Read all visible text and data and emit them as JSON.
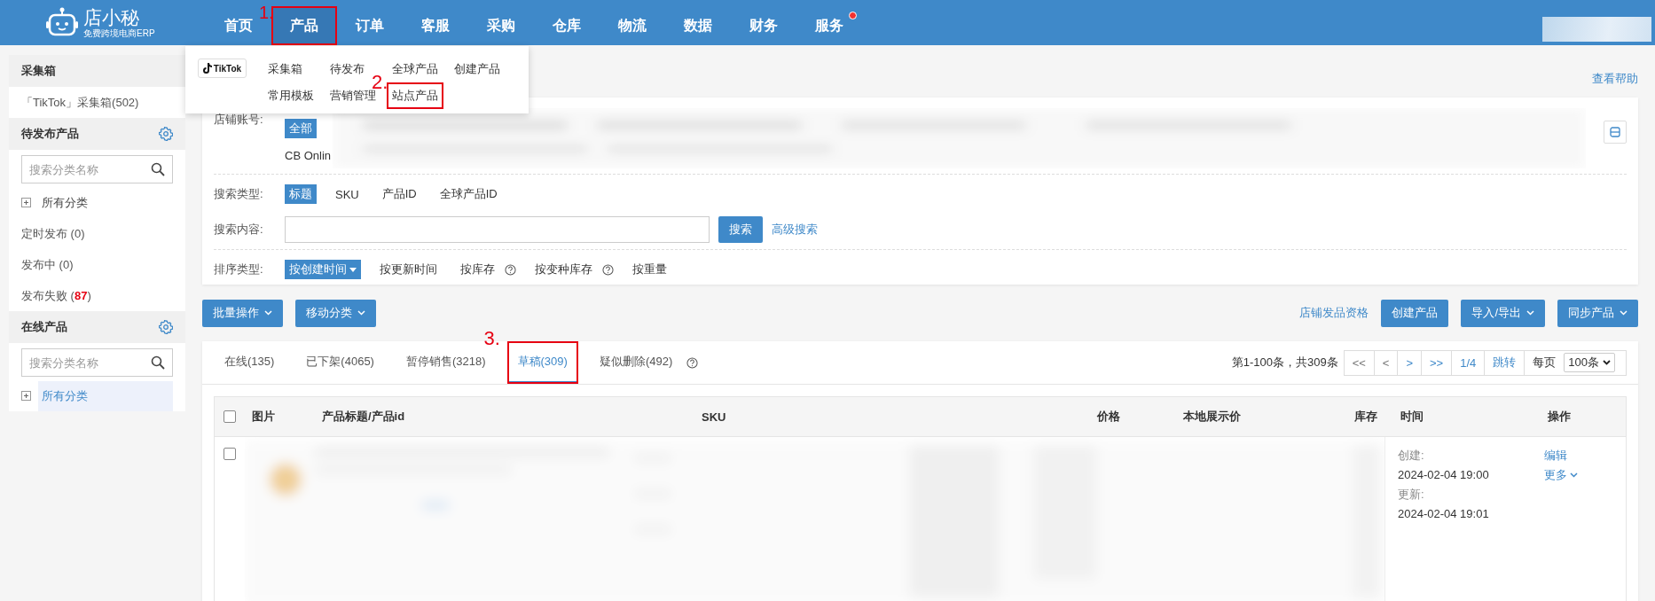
{
  "nav": {
    "logo": {
      "name": "店小秘",
      "tagline": "免费跨境电商ERP"
    },
    "items": [
      {
        "label": "首页",
        "selected": false,
        "dot": false
      },
      {
        "label": "产品",
        "selected": true,
        "dot": false,
        "annotation": "1."
      },
      {
        "label": "订单",
        "selected": false,
        "dot": false
      },
      {
        "label": "客服",
        "selected": false,
        "dot": false
      },
      {
        "label": "采购",
        "selected": false,
        "dot": false
      },
      {
        "label": "仓库",
        "selected": false,
        "dot": false
      },
      {
        "label": "物流",
        "selected": false,
        "dot": false
      },
      {
        "label": "数据",
        "selected": false,
        "dot": false
      },
      {
        "label": "财务",
        "selected": false,
        "dot": false
      },
      {
        "label": "服务",
        "selected": false,
        "dot": true
      }
    ]
  },
  "dropdown": {
    "brand": "TikTok",
    "rows": [
      [
        {
          "label": "采集箱"
        },
        {
          "label": "待发布"
        },
        {
          "label": "全球产品"
        },
        {
          "label": "创建产品"
        }
      ],
      [
        {
          "label": "常用模板"
        },
        {
          "label": "营销管理"
        },
        {
          "label": "站点产品",
          "annotation": "2."
        }
      ]
    ]
  },
  "help_link": "查看帮助",
  "sidebar": [
    {
      "title": "采集箱",
      "settings": false,
      "items": [
        {
          "kind": "link",
          "label": "「TikTok」采集箱(502)",
          "selected": false
        }
      ]
    },
    {
      "title": "待发布产品",
      "settings": true,
      "search_placeholder": "搜索分类名称",
      "items": [
        {
          "kind": "tree",
          "label": "所有分类",
          "selected": false
        },
        {
          "kind": "link",
          "label": "定时发布 (0)",
          "selected": false
        },
        {
          "kind": "link",
          "label": "发布中 (0)",
          "selected": false
        },
        {
          "kind": "link",
          "label": "发布失败 (**87**)",
          "selected": false
        }
      ]
    },
    {
      "title": "在线产品",
      "settings": true,
      "search_placeholder": "搜索分类名称",
      "items": [
        {
          "kind": "tree",
          "label": "所有分类",
          "selected": true
        }
      ]
    }
  ],
  "filters": {
    "store": {
      "label": "店铺账号:",
      "options": [
        {
          "label": "全部",
          "selected": true
        }
      ],
      "account": "CB Onlin"
    },
    "search_type": {
      "label": "搜索类型:",
      "options": [
        {
          "label": "标题",
          "selected": true
        },
        {
          "label": "SKU",
          "selected": false
        },
        {
          "label": "产品ID",
          "selected": false
        },
        {
          "label": "全球产品ID",
          "selected": false
        }
      ]
    },
    "search_content": {
      "label": "搜索内容:",
      "button": "搜索",
      "link": "高级搜索"
    },
    "sort": {
      "label": "排序类型:",
      "options": [
        {
          "label": "按创建时间",
          "selected": true,
          "dropdown": true,
          "help": false
        },
        {
          "label": "按更新时间",
          "selected": false,
          "dropdown": false,
          "help": false
        },
        {
          "label": "按库存",
          "selected": false,
          "dropdown": false,
          "help": true
        },
        {
          "label": "按变种库存",
          "selected": false,
          "dropdown": false,
          "help": true
        },
        {
          "label": "按重量",
          "selected": false,
          "dropdown": false,
          "help": false
        }
      ]
    }
  },
  "actions": {
    "left": [
      {
        "label": "批量操作",
        "caret": true
      },
      {
        "label": "移动分类",
        "caret": true
      }
    ],
    "link": "店铺发品资格",
    "right": [
      {
        "label": "创建产品",
        "caret": false
      },
      {
        "label": "导入/导出",
        "caret": true
      },
      {
        "label": "同步产品",
        "caret": true
      }
    ]
  },
  "tabs": [
    {
      "label": "在线(135)",
      "selected": false,
      "help": false
    },
    {
      "label": "已下架(4065)",
      "selected": false,
      "help": false
    },
    {
      "label": "暂停销售(3218)",
      "selected": false,
      "help": false
    },
    {
      "label": "草稿(309)",
      "selected": true,
      "help": false,
      "annotation": "3."
    },
    {
      "label": "疑似删除(492)",
      "selected": false,
      "help": true
    }
  ],
  "pagination": {
    "summary": "第1-100条，共309条",
    "pages": [
      {
        "label": "<<",
        "disabled": true
      },
      {
        "label": "<",
        "disabled": true
      },
      {
        "label": ">",
        "disabled": false
      },
      {
        "label": ">>",
        "disabled": false
      },
      {
        "label": "1/4",
        "disabled": false
      }
    ],
    "jump": "跳转",
    "per_page_label": "每页",
    "per_page": "100条"
  },
  "table": {
    "all_checked": false,
    "columns": [
      "图片",
      "产品标题/产品id",
      "SKU",
      "价格",
      "本地展示价",
      "库存",
      "时间",
      "操作"
    ],
    "rows": [
      {
        "checked": false,
        "created_label": "创建:",
        "created": "2024-02-04 19:00",
        "updated_label": "更新:",
        "updated": "2024-02-04 19:01",
        "actions": [
          {
            "label": "编辑",
            "caret": false
          },
          {
            "label": "更多",
            "caret": true
          }
        ]
      }
    ]
  }
}
